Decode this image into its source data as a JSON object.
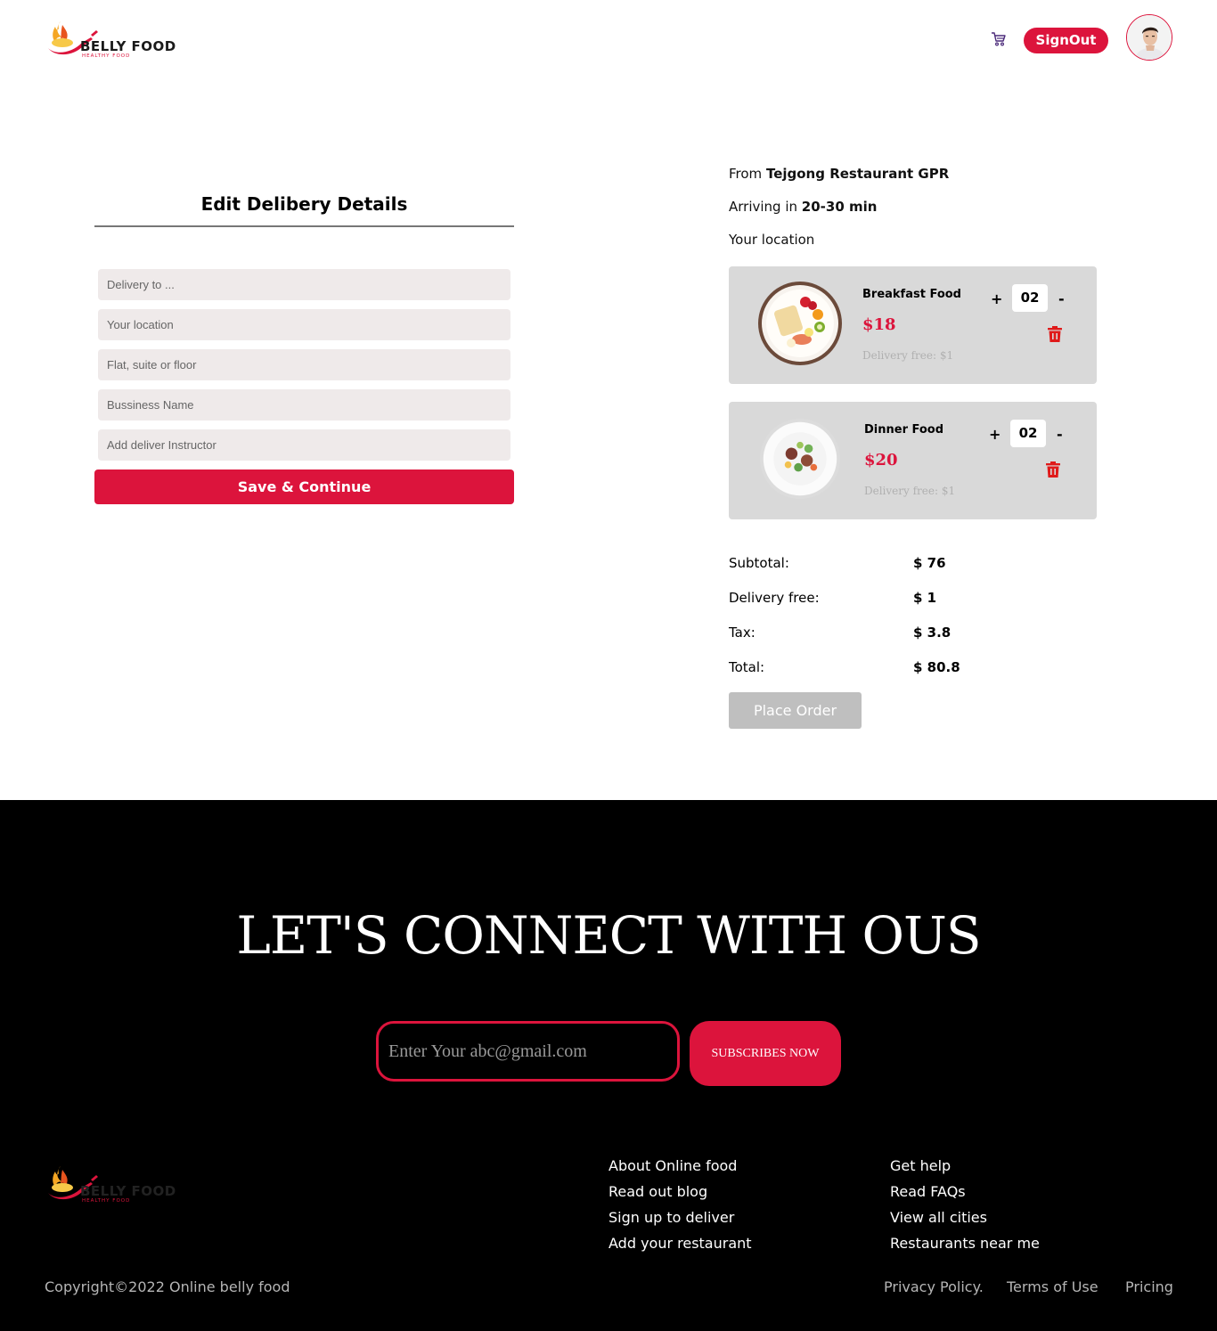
{
  "brand": {
    "name": "BELLY FOOD",
    "tagline": "HEALTHY FOOD"
  },
  "header": {
    "cart_icon": "cart-icon",
    "signout_label": "SignOut",
    "avatar_icon": "user-avatar"
  },
  "form": {
    "title": "Edit Delibery Details",
    "fields": [
      {
        "placeholder": "Delivery to ...",
        "value": ""
      },
      {
        "placeholder": "Your location",
        "value": ""
      },
      {
        "placeholder": "Flat, suite or floor",
        "value": ""
      },
      {
        "placeholder": "Bussiness Name",
        "value": ""
      },
      {
        "placeholder": "Add deliver Instructor",
        "value": ""
      }
    ],
    "save_label": "Save & Continue"
  },
  "order": {
    "from_prefix": "From",
    "restaurant": "Tejgong Restaurant GPR",
    "arriving_prefix": "Arriving in",
    "arriving_time": "20-30 min",
    "location_label": "Your location",
    "items": [
      {
        "name": "Breakfast Food",
        "price": "$18",
        "fee": "Delivery free: $1",
        "qty": "02",
        "plus": "+",
        "minus": "-"
      },
      {
        "name": "Dinner Food",
        "price": "$20",
        "fee": "Delivery free: $1",
        "qty": "02",
        "plus": "+",
        "minus": "-"
      }
    ],
    "summary": [
      {
        "label": "Subtotal:",
        "value": "$ 76"
      },
      {
        "label": "Delivery free:",
        "value": "$ 1"
      },
      {
        "label": "Tax:",
        "value": "$ 3.8"
      },
      {
        "label": "Total:",
        "value": "$ 80.8"
      }
    ],
    "place_label": "Place Order"
  },
  "footer": {
    "headline": "LET'S CONNECT WITH OUS",
    "email_placeholder": "Enter Your abc@gmail.com",
    "subscribe_label": "SUBSCRIBES NOW",
    "links_col1": [
      "About Online food",
      "Read out blog",
      "Sign up to deliver",
      "Add your restaurant"
    ],
    "links_col2": [
      "Get help",
      "Read FAQs",
      "View all cities",
      "Restaurants near me"
    ],
    "copyright": "Copyright©2022 Online belly food",
    "legal": [
      "Privacy Policy.",
      "Terms of Use",
      "Pricing"
    ]
  },
  "colors": {
    "accent": "#dc143c",
    "card": "#d9d9d9",
    "field": "#efeaea",
    "disabled": "#bfbfbf"
  }
}
